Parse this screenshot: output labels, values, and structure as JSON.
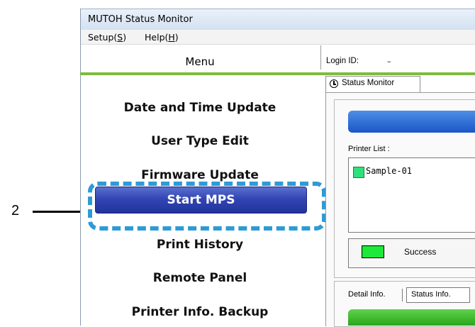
{
  "callout": {
    "number": "2"
  },
  "window": {
    "title": "MUTOH Status Monitor",
    "menubar": {
      "setup": {
        "text": "Setup(",
        "key": "S",
        "close": ")"
      },
      "help": {
        "text": "Help(",
        "key": "H",
        "close": ")"
      }
    }
  },
  "menu": {
    "header": "Menu",
    "items": [
      {
        "label": "Date and Time Update"
      },
      {
        "label": "User Type Edit"
      },
      {
        "label": "Firmware Update"
      },
      {
        "label": "Start MPS"
      },
      {
        "label": "Print History"
      },
      {
        "label": "Remote Panel"
      },
      {
        "label": "Printer Info. Backup"
      }
    ]
  },
  "login": {
    "label": "Login ID:",
    "value": "–"
  },
  "status_monitor": {
    "tab_label": "Status Monitor",
    "printer_list_label": "Printer List :",
    "printers": [
      {
        "name": "Sample-01",
        "color": "#2ee07a"
      }
    ],
    "status": {
      "text": "Success",
      "color": "#1ee83a"
    },
    "detail_tabs": [
      {
        "label": "Detail Info."
      },
      {
        "label": "Status Info."
      }
    ]
  },
  "colors": {
    "accent_green": "#7dbb3f",
    "highlight": "#2d9bd6",
    "button_blue": "#3245b4"
  }
}
